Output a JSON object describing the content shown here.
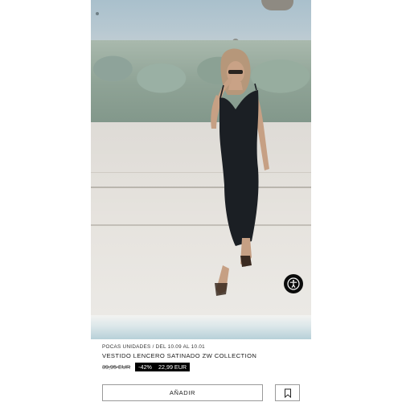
{
  "product": {
    "image_alt": "Modelo con vestido lencero negro",
    "stock_note": "POCAS UNIDADES / DEL 10.09 AL 10.01",
    "name": "VESTIDO LENCERO SATINADO ZW COLLECTION",
    "price_original": "39,95 EUR",
    "discount": "-42%",
    "price_sale": "22,99 EUR"
  },
  "actions": {
    "add_label": "AÑADIR",
    "bookmark_icon": "bookmark-icon"
  },
  "accessibility": {
    "icon": "accessibility-icon"
  },
  "colors": {
    "sale_bg": "#000000",
    "sale_text": "#ffffff",
    "button_border": "#9a9a9a"
  }
}
